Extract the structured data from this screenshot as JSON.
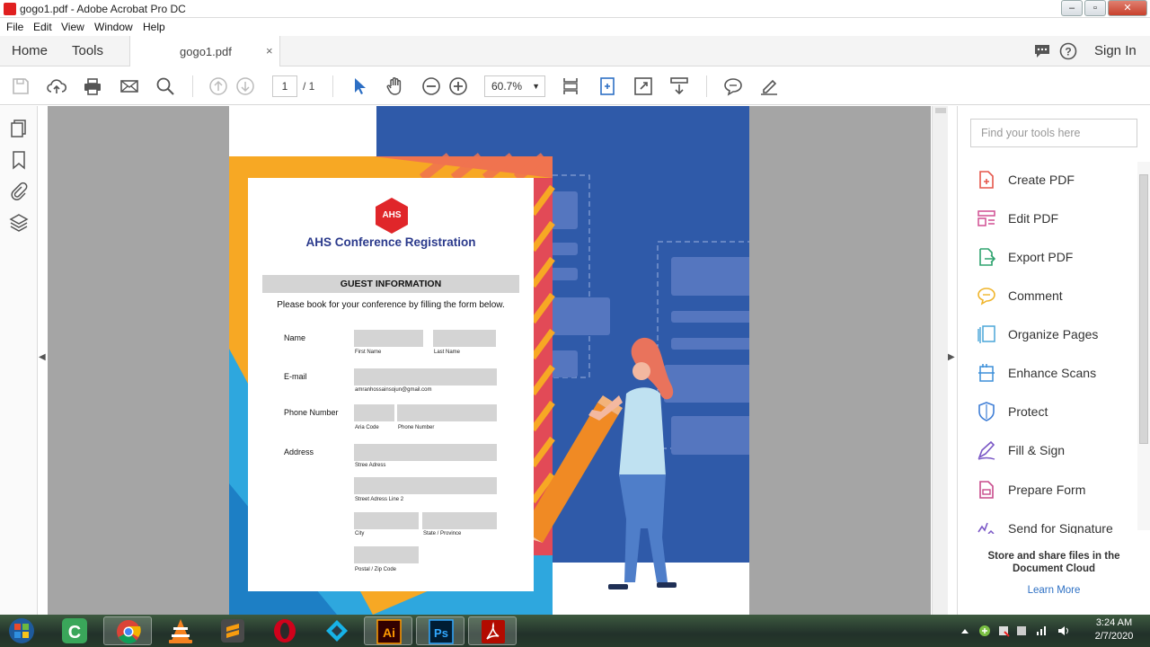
{
  "window": {
    "title": "gogo1.pdf - Adobe Acrobat Pro DC"
  },
  "menu": [
    "File",
    "Edit",
    "View",
    "Window",
    "Help"
  ],
  "tabs": {
    "home": "Home",
    "tools": "Tools",
    "document": "gogo1.pdf",
    "close": "×",
    "sign_in": "Sign In"
  },
  "toolbar": {
    "page_current": "1",
    "page_total": "/ 1",
    "zoom": "60.7%"
  },
  "document": {
    "logo_text": "AHS",
    "form_title": "AHS Conference Registration",
    "section": "GUEST INFORMATION",
    "intro": "Please book for your conference by filling the form below.",
    "fields": {
      "name_label": "Name",
      "first_name": "First Name",
      "last_name": "Last Name",
      "email_label": "E-mail",
      "email_hint": "amranhossainsojun@gmail.com",
      "phone_label": "Phone Number",
      "area_code": "Aria Code",
      "phone_number": "Phone Number",
      "address_label": "Address",
      "street": "Stree Adress",
      "street2": "Street Adress Line 2",
      "city": "City",
      "state": "State / Province",
      "postal": "Postal / Zip Code"
    }
  },
  "tools_panel": {
    "search_placeholder": "Find your tools here",
    "items": [
      {
        "label": "Create PDF",
        "icon": "create-pdf-icon",
        "color": "#e5574b"
      },
      {
        "label": "Edit PDF",
        "icon": "edit-pdf-icon",
        "color": "#d04f92"
      },
      {
        "label": "Export PDF",
        "icon": "export-pdf-icon",
        "color": "#2fa36f"
      },
      {
        "label": "Comment",
        "icon": "comment-icon",
        "color": "#f0b52c"
      },
      {
        "label": "Organize Pages",
        "icon": "organize-pages-icon",
        "color": "#4aa6d8"
      },
      {
        "label": "Enhance Scans",
        "icon": "enhance-scans-icon",
        "color": "#3d8fd9"
      },
      {
        "label": "Protect",
        "icon": "protect-icon",
        "color": "#3f7ed6"
      },
      {
        "label": "Fill & Sign",
        "icon": "fill-sign-icon",
        "color": "#7a57c6"
      },
      {
        "label": "Prepare Form",
        "icon": "prepare-form-icon",
        "color": "#c84b8c"
      },
      {
        "label": "Send for Signature",
        "icon": "send-signature-icon",
        "color": "#7a57c6"
      }
    ],
    "store_text": "Store and share files in the Document Cloud",
    "learn_more": "Learn More"
  },
  "taskbar": {
    "apps": [
      "start-orb",
      "camtasia",
      "chrome",
      "vlc",
      "sublime-text",
      "opera",
      "kodi",
      "illustrator",
      "photoshop",
      "acrobat"
    ],
    "time": "3:24 AM",
    "date": "2/7/2020"
  }
}
